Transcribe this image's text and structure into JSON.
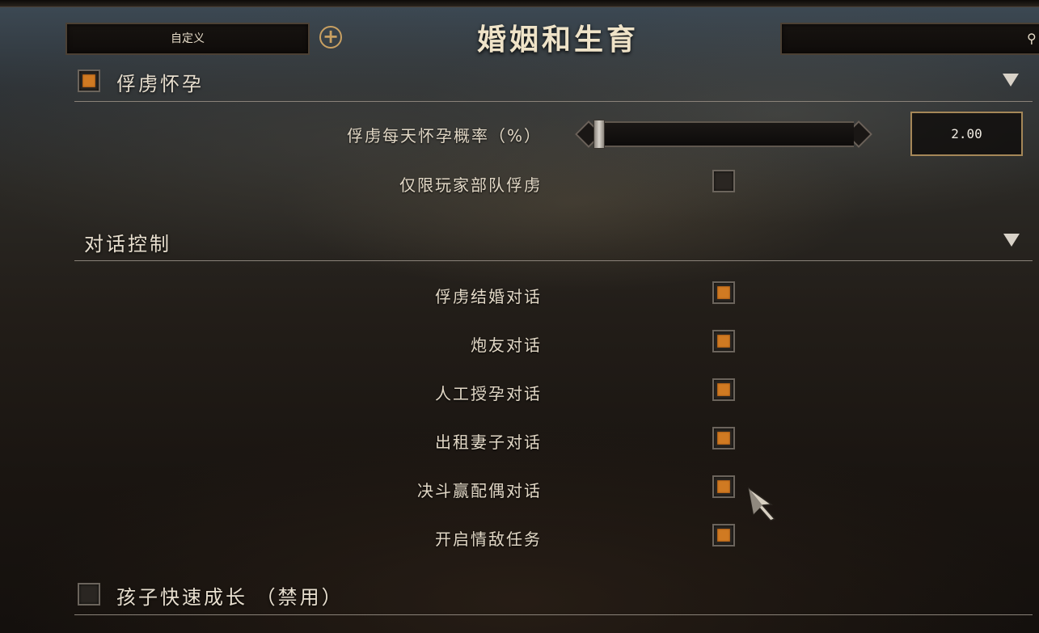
{
  "header": {
    "preset_label": "自定义",
    "title": "婚姻和生育",
    "search_value": ""
  },
  "sections": [
    {
      "title": "俘虏怀孕",
      "has_checkbox": true,
      "checked": true,
      "options": [
        {
          "label": "俘虏每天怀孕概率（%）",
          "type": "slider",
          "value": "2.00",
          "fraction": 0.0
        },
        {
          "label": "仅限玩家部队俘虏",
          "type": "checkbox",
          "checked": false
        }
      ]
    },
    {
      "title": "对话控制",
      "has_checkbox": false,
      "options": [
        {
          "label": "俘虏结婚对话",
          "type": "checkbox",
          "checked": true
        },
        {
          "label": "炮友对话",
          "type": "checkbox",
          "checked": true
        },
        {
          "label": "人工授孕对话",
          "type": "checkbox",
          "checked": true
        },
        {
          "label": "出租妻子对话",
          "type": "checkbox",
          "checked": true
        },
        {
          "label": "决斗赢配偶对话",
          "type": "checkbox",
          "checked": true
        },
        {
          "label": "开启情敌任务",
          "type": "checkbox",
          "checked": true
        }
      ]
    },
    {
      "title": "孩子快速成长 （禁用）",
      "has_checkbox": true,
      "checked": false
    }
  ],
  "icons": {
    "add": "plus-circle-icon",
    "search": "search-icon",
    "collapse": "triangle-down-icon",
    "cursor": "arrow-cursor-icon"
  },
  "colors": {
    "accent": "#d07a22",
    "gold": "#c9a062"
  }
}
